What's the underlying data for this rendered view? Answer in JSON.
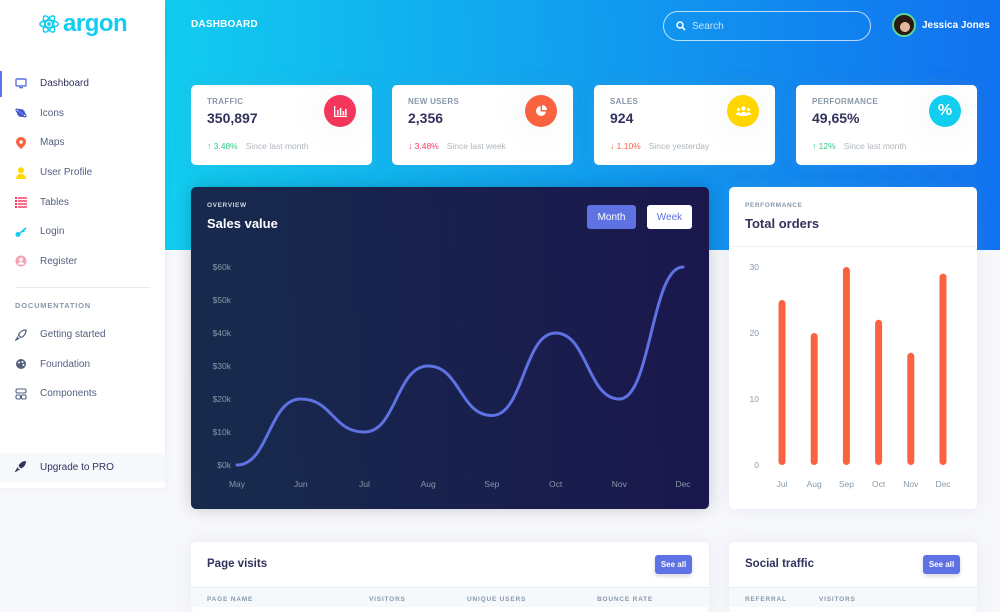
{
  "brand": {
    "name": "argon",
    "color": "#11cdef"
  },
  "sidebar": {
    "items": [
      {
        "label": "Dashboard",
        "icon": "tv-icon",
        "color": "#5e72e4",
        "active": true
      },
      {
        "label": "Icons",
        "icon": "planet-icon",
        "color": "#5e72e4"
      },
      {
        "label": "Maps",
        "icon": "pin-icon",
        "color": "#fb6340"
      },
      {
        "label": "User Profile",
        "icon": "user-icon",
        "color": "#ffd600"
      },
      {
        "label": "Tables",
        "icon": "list-icon",
        "color": "#f5365c"
      },
      {
        "label": "Login",
        "icon": "key-icon",
        "color": "#11cdef"
      },
      {
        "label": "Register",
        "icon": "circle-user-icon",
        "color": "#f3a4b5"
      }
    ],
    "doc_heading": "DOCUMENTATION",
    "doc_items": [
      {
        "label": "Getting started",
        "icon": "rocket-icon"
      },
      {
        "label": "Foundation",
        "icon": "palette-icon"
      },
      {
        "label": "Components",
        "icon": "components-icon"
      }
    ],
    "upgrade": {
      "label": "Upgrade to PRO",
      "icon": "rocket-icon"
    }
  },
  "header": {
    "title": "DASHBOARD",
    "search_placeholder": "Search",
    "user_name": "Jessica Jones"
  },
  "stats": [
    {
      "label": "TRAFFIC",
      "value": "350,897",
      "change": "3.48%",
      "direction": "up",
      "since": "Since last month",
      "icon": "chart-bar-icon",
      "color": "#f5365c"
    },
    {
      "label": "NEW USERS",
      "value": "2,356",
      "change": "3.48%",
      "direction": "down",
      "since": "Since last week",
      "icon": "chart-pie-icon",
      "color": "#fb6340"
    },
    {
      "label": "SALES",
      "value": "924",
      "change": "1.10%",
      "direction": "down",
      "since": "Since yesterday",
      "icon": "users-icon",
      "color": "#ffd600"
    },
    {
      "label": "PERFORMANCE",
      "value": "49,65%",
      "change": "12%",
      "direction": "up",
      "since": "Since last month",
      "icon": "percent-icon",
      "color": "#11cdef"
    }
  ],
  "sales_card": {
    "subtitle": "OVERVIEW",
    "title": "Sales value",
    "btn_month": "Month",
    "btn_week": "Week"
  },
  "orders_card": {
    "subtitle": "PERFORMANCE",
    "title": "Total orders"
  },
  "page_visits": {
    "title": "Page visits",
    "see_all": "See all",
    "columns": [
      "PAGE NAME",
      "VISITORS",
      "UNIQUE USERS",
      "BOUNCE RATE"
    ]
  },
  "social_traffic": {
    "title": "Social traffic",
    "see_all": "See all",
    "columns": [
      "REFERRAL",
      "VISITORS"
    ]
  },
  "chart_data": [
    {
      "type": "line",
      "title": "Sales value",
      "categories": [
        "May",
        "Jun",
        "Jul",
        "Aug",
        "Sep",
        "Oct",
        "Nov",
        "Dec"
      ],
      "values": [
        0,
        20,
        10,
        30,
        15,
        40,
        20,
        60
      ],
      "yticks": [
        "$0k",
        "$10k",
        "$20k",
        "$30k",
        "$40k",
        "$50k",
        "$60k"
      ],
      "ylim": [
        0,
        60
      ],
      "color": "#5e72e4",
      "grid": false
    },
    {
      "type": "bar",
      "title": "Total orders",
      "categories": [
        "Jul",
        "Aug",
        "Sep",
        "Oct",
        "Nov",
        "Dec"
      ],
      "values": [
        25,
        20,
        30,
        22,
        17,
        29
      ],
      "yticks": [
        "0",
        "10",
        "20",
        "30"
      ],
      "ylim": [
        0,
        30
      ],
      "color": "#fb6340",
      "grid": false
    }
  ]
}
